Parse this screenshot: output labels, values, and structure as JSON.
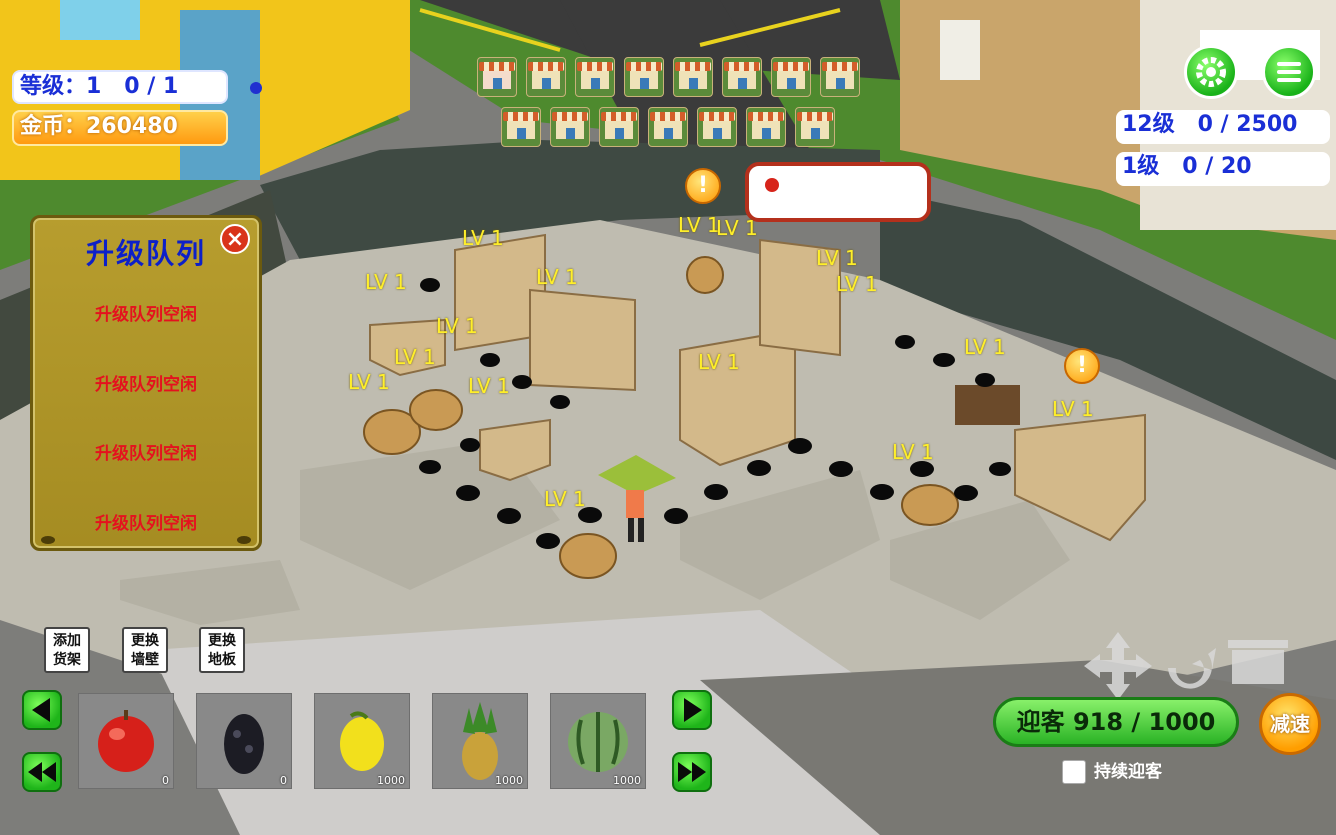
{
  "hud": {
    "level_text": "等级：1   0 / 1",
    "coins_text": "金币：260480",
    "right_stat_1": "12级   0 / 2500",
    "right_stat_2": "1级   0 / 20"
  },
  "shop_icons": {
    "row1_count": 8,
    "row2_count": 7,
    "icon": "shop-stall-icon"
  },
  "upgrade_queue": {
    "title": "升级队列",
    "items": [
      "升级队列空闲",
      "升级队列空闲",
      "升级队列空闲",
      "升级队列空闲"
    ],
    "close_icon": "close-icon"
  },
  "scene_labels": {
    "lv": "LV 1"
  },
  "tools": [
    {
      "label": "添加\n货架"
    },
    {
      "label": "更换\n墙壁"
    },
    {
      "label": "更换\n地板"
    }
  ],
  "fruits": [
    {
      "name": "apple",
      "icon": "apple-icon",
      "count": "0"
    },
    {
      "name": "blackberry",
      "icon": "blackberry-icon",
      "count": "0"
    },
    {
      "name": "lemon",
      "icon": "lemon-icon",
      "count": "1000"
    },
    {
      "name": "pineapple",
      "icon": "pineapple-icon",
      "count": "1000"
    },
    {
      "name": "watermelon",
      "icon": "watermelon-icon",
      "count": "1000"
    }
  ],
  "welcome": {
    "label": "迎客  918 / 1000",
    "slow_label": "减速",
    "continuous_label": "持续迎客",
    "continuous_checked": false
  },
  "colors": {
    "accent_green": "#2ab325",
    "queue_red": "#e4121e",
    "hud_blue": "#1a2fd6"
  }
}
